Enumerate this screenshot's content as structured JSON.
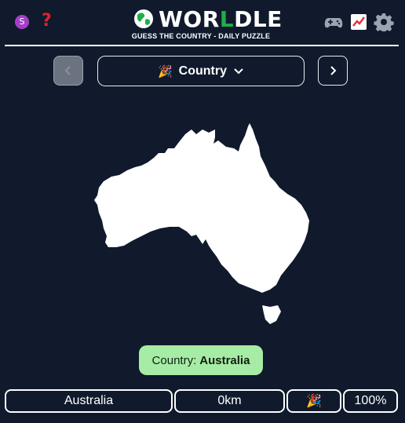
{
  "header": {
    "avatar_letter": "S",
    "help_label": "?",
    "brand_prefix": "WOR",
    "brand_highlight": "L",
    "brand_suffix": "DLE",
    "subtitle": "GUESS THE COUNTRY - DAILY PUZZLE",
    "icons": [
      "avatar-icon",
      "help-icon",
      "globe-icon",
      "gamepad-icon",
      "stats-chart-icon",
      "gear-icon"
    ]
  },
  "selector": {
    "emoji": "🎉",
    "label": "Country",
    "prev_label": "‹",
    "next_label": "›"
  },
  "result": {
    "prefix": "Country:",
    "answer": "Australia"
  },
  "guesses": [
    {
      "country": "Australia",
      "distance": "0km",
      "direction": "🎉",
      "proximity": "100%"
    }
  ],
  "colors": {
    "background": "#101a2c",
    "brand_green": "#1fae4a",
    "result_bg": "#a7eca6"
  }
}
